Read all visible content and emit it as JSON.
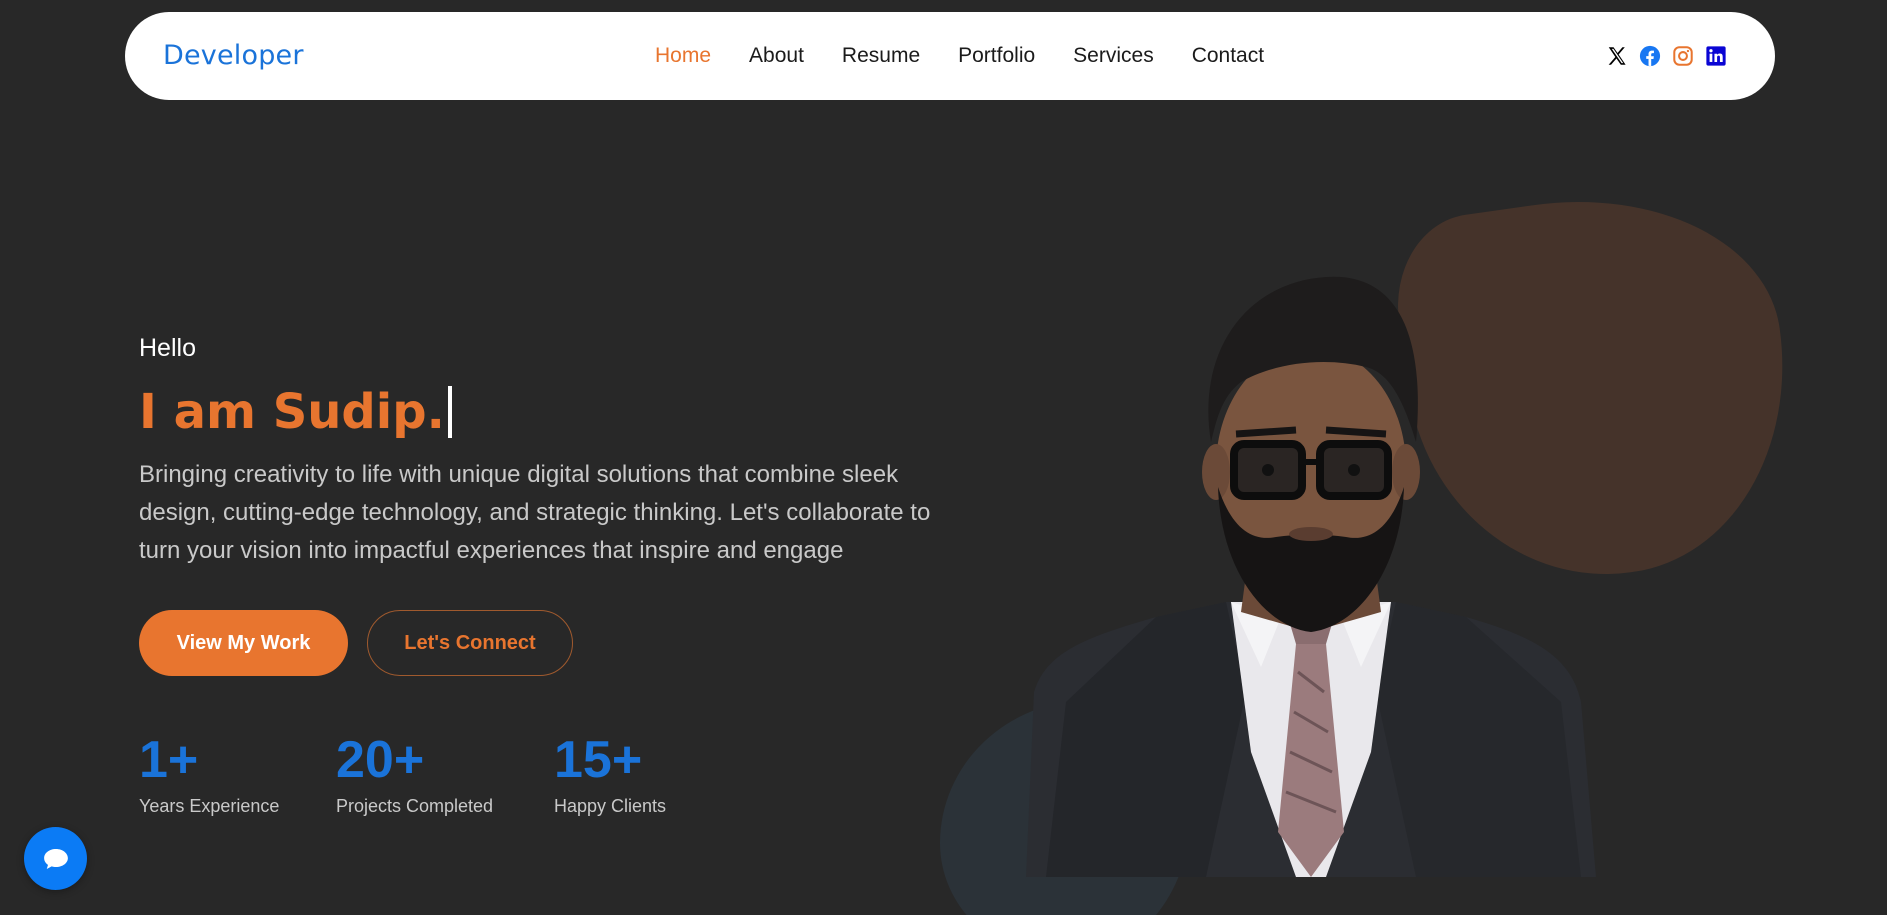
{
  "brand": "Developer",
  "nav": {
    "items": [
      {
        "label": "Home",
        "active": true
      },
      {
        "label": "About",
        "active": false
      },
      {
        "label": "Resume",
        "active": false
      },
      {
        "label": "Portfolio",
        "active": false
      },
      {
        "label": "Services",
        "active": false
      },
      {
        "label": "Contact",
        "active": false
      }
    ]
  },
  "social": [
    {
      "icon": "x-icon",
      "color": "#000000"
    },
    {
      "icon": "facebook-icon",
      "color": "#1877f2"
    },
    {
      "icon": "instagram-icon",
      "color": "#e8752f"
    },
    {
      "icon": "linkedin-icon",
      "color": "#0a05d4"
    }
  ],
  "hero": {
    "greeting": "Hello",
    "headline": "I am Sudip.",
    "intro": "Bringing creativity to life with unique digital solutions that combine sleek design, cutting-edge technology, and strategic thinking. Let's collaborate to turn your vision into impactful experiences that inspire and engage",
    "primary_button": "View My Work",
    "secondary_button": "Let's Connect"
  },
  "stats": [
    {
      "value": "1+",
      "label": "Years Experience"
    },
    {
      "value": "20+",
      "label": "Projects Completed"
    },
    {
      "value": "15+",
      "label": "Happy Clients"
    }
  ],
  "colors": {
    "background": "#282828",
    "accent": "#e8752f",
    "brand_blue": "#1a73d9",
    "chat_button": "#0b7bf5"
  },
  "chat": {
    "icon": "chat-bubble-icon"
  }
}
